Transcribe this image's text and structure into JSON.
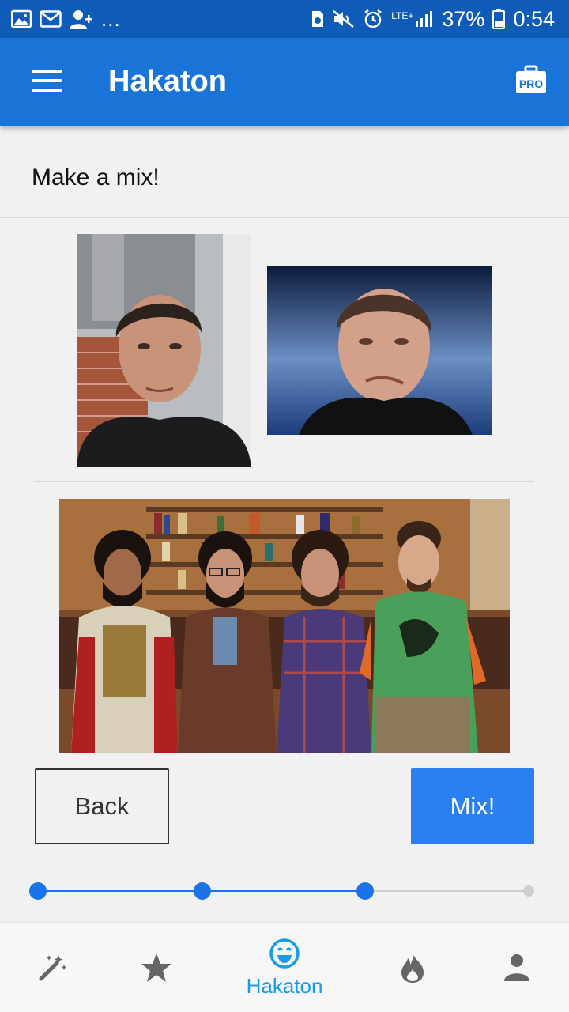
{
  "status_bar": {
    "icons_left": [
      "gallery-icon",
      "mail-icon",
      "add-contact-icon"
    ],
    "more": "...",
    "icons_right": [
      "sim-icon",
      "mute-icon",
      "alarm-icon",
      "lte-signal-icon",
      "battery-icon"
    ],
    "network": "LTE+",
    "battery": "37%",
    "time": "0:54"
  },
  "app_bar": {
    "title": "Hakaton",
    "menu_icon": "menu-icon",
    "pro_icon": "pro-briefcase-icon",
    "pro_badge": "PRO",
    "color": "#1a73d6"
  },
  "main": {
    "subtitle": "Make a mix!",
    "images": {
      "user_face": "user-face-photo",
      "celebrity_face": "celebrity-face-photo",
      "target_scene": "group-scene-photo"
    }
  },
  "actions": {
    "back_label": "Back",
    "mix_label": "Mix!",
    "mix_color": "#2a7ff2"
  },
  "stepper": {
    "total_steps": 4,
    "current_step": 3,
    "active_color": "#1a73e8",
    "inactive_color": "#cfcfcf"
  },
  "bottom_nav": {
    "items": [
      {
        "icon": "magic-wand-icon",
        "label": ""
      },
      {
        "icon": "star-icon",
        "label": ""
      },
      {
        "icon": "smiley-icon",
        "label": "Hakaton",
        "active": true
      },
      {
        "icon": "flame-icon",
        "label": ""
      },
      {
        "icon": "person-icon",
        "label": ""
      }
    ],
    "active_color": "#1a9be8",
    "inactive_color": "#666666"
  }
}
